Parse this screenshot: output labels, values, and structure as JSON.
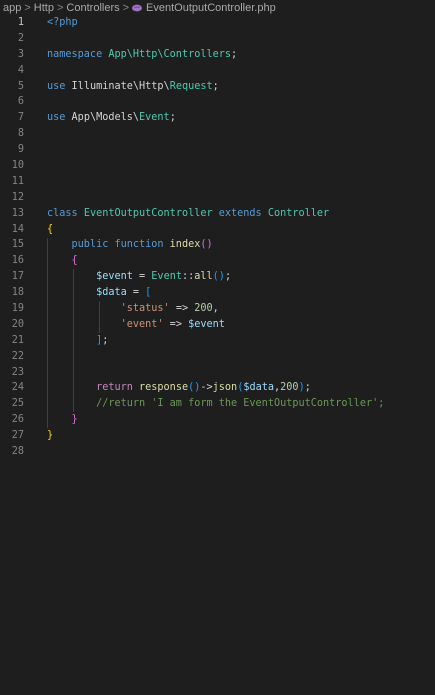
{
  "breadcrumb": {
    "items": [
      "app",
      "Http",
      "Controllers",
      "EventOutputController.php"
    ],
    "separator": ">"
  },
  "editor": {
    "active_line": 1,
    "line_numbers": [
      "1",
      "2",
      "3",
      "4",
      "5",
      "6",
      "7",
      "8",
      "9",
      "10",
      "11",
      "12",
      "13",
      "14",
      "15",
      "16",
      "17",
      "18",
      "19",
      "20",
      "21",
      "22",
      "23",
      "24",
      "25",
      "26",
      "27",
      "28"
    ],
    "lines": [
      [
        {
          "t": "<?php",
          "c": "tag"
        }
      ],
      [],
      [
        {
          "t": "namespace ",
          "c": "kw"
        },
        {
          "t": "App\\Http\\Controllers",
          "c": "ns"
        },
        {
          "t": ";",
          "c": "plain"
        }
      ],
      [],
      [
        {
          "t": "use ",
          "c": "kw"
        },
        {
          "t": "Illuminate\\Http\\",
          "c": "plain"
        },
        {
          "t": "Request",
          "c": "cls"
        },
        {
          "t": ";",
          "c": "plain"
        }
      ],
      [],
      [
        {
          "t": "use ",
          "c": "kw"
        },
        {
          "t": "App\\Models\\",
          "c": "plain"
        },
        {
          "t": "Event",
          "c": "cls"
        },
        {
          "t": ";",
          "c": "plain"
        }
      ],
      [],
      [],
      [],
      [],
      [],
      [
        {
          "t": "class ",
          "c": "kw"
        },
        {
          "t": "EventOutputController ",
          "c": "cls"
        },
        {
          "t": "extends ",
          "c": "kw"
        },
        {
          "t": "Controller",
          "c": "cls"
        }
      ],
      [
        {
          "t": "{",
          "c": "b1"
        }
      ],
      [
        {
          "t": "    public ",
          "c": "kw"
        },
        {
          "t": "function ",
          "c": "kw"
        },
        {
          "t": "index",
          "c": "fn"
        },
        {
          "t": "()",
          "c": "b2"
        }
      ],
      [
        {
          "t": "    {",
          "c": "b2"
        }
      ],
      [
        {
          "t": "        ",
          "c": "plain"
        },
        {
          "t": "$event",
          "c": "var"
        },
        {
          "t": " = ",
          "c": "plain"
        },
        {
          "t": "Event",
          "c": "cls"
        },
        {
          "t": "::",
          "c": "plain"
        },
        {
          "t": "all",
          "c": "fn"
        },
        {
          "t": "()",
          "c": "b3"
        },
        {
          "t": ";",
          "c": "plain"
        }
      ],
      [
        {
          "t": "        ",
          "c": "plain"
        },
        {
          "t": "$data",
          "c": "var"
        },
        {
          "t": " = ",
          "c": "plain"
        },
        {
          "t": "[",
          "c": "b3"
        }
      ],
      [
        {
          "t": "            ",
          "c": "plain"
        },
        {
          "t": "'status'",
          "c": "str"
        },
        {
          "t": " => ",
          "c": "plain"
        },
        {
          "t": "200",
          "c": "num"
        },
        {
          "t": ",",
          "c": "plain"
        }
      ],
      [
        {
          "t": "            ",
          "c": "plain"
        },
        {
          "t": "'event'",
          "c": "str"
        },
        {
          "t": " => ",
          "c": "plain"
        },
        {
          "t": "$event",
          "c": "var"
        }
      ],
      [
        {
          "t": "        ",
          "c": "plain"
        },
        {
          "t": "]",
          "c": "b3"
        },
        {
          "t": ";",
          "c": "plain"
        }
      ],
      [],
      [],
      [
        {
          "t": "        ",
          "c": "plain"
        },
        {
          "t": "return ",
          "c": "ctl"
        },
        {
          "t": "response",
          "c": "fn"
        },
        {
          "t": "()",
          "c": "b3"
        },
        {
          "t": "->",
          "c": "plain"
        },
        {
          "t": "json",
          "c": "fn"
        },
        {
          "t": "(",
          "c": "b3"
        },
        {
          "t": "$data",
          "c": "var"
        },
        {
          "t": ",",
          "c": "plain"
        },
        {
          "t": "200",
          "c": "num"
        },
        {
          "t": ")",
          "c": "b3"
        },
        {
          "t": ";",
          "c": "plain"
        }
      ],
      [
        {
          "t": "        ",
          "c": "plain"
        },
        {
          "t": "//return 'I am form the EventOutputController';",
          "c": "cmt"
        }
      ],
      [
        {
          "t": "    }",
          "c": "b2"
        }
      ],
      [
        {
          "t": "}",
          "c": "b1"
        }
      ],
      []
    ]
  },
  "colors": {
    "background": "#1e1e1e",
    "keyword": "#569cd6",
    "control": "#c586c0",
    "class": "#4ec9b0",
    "function": "#dcdcaa",
    "variable": "#9cdcfe",
    "string": "#ce9178",
    "number": "#b5cea8",
    "comment": "#6a9955"
  }
}
